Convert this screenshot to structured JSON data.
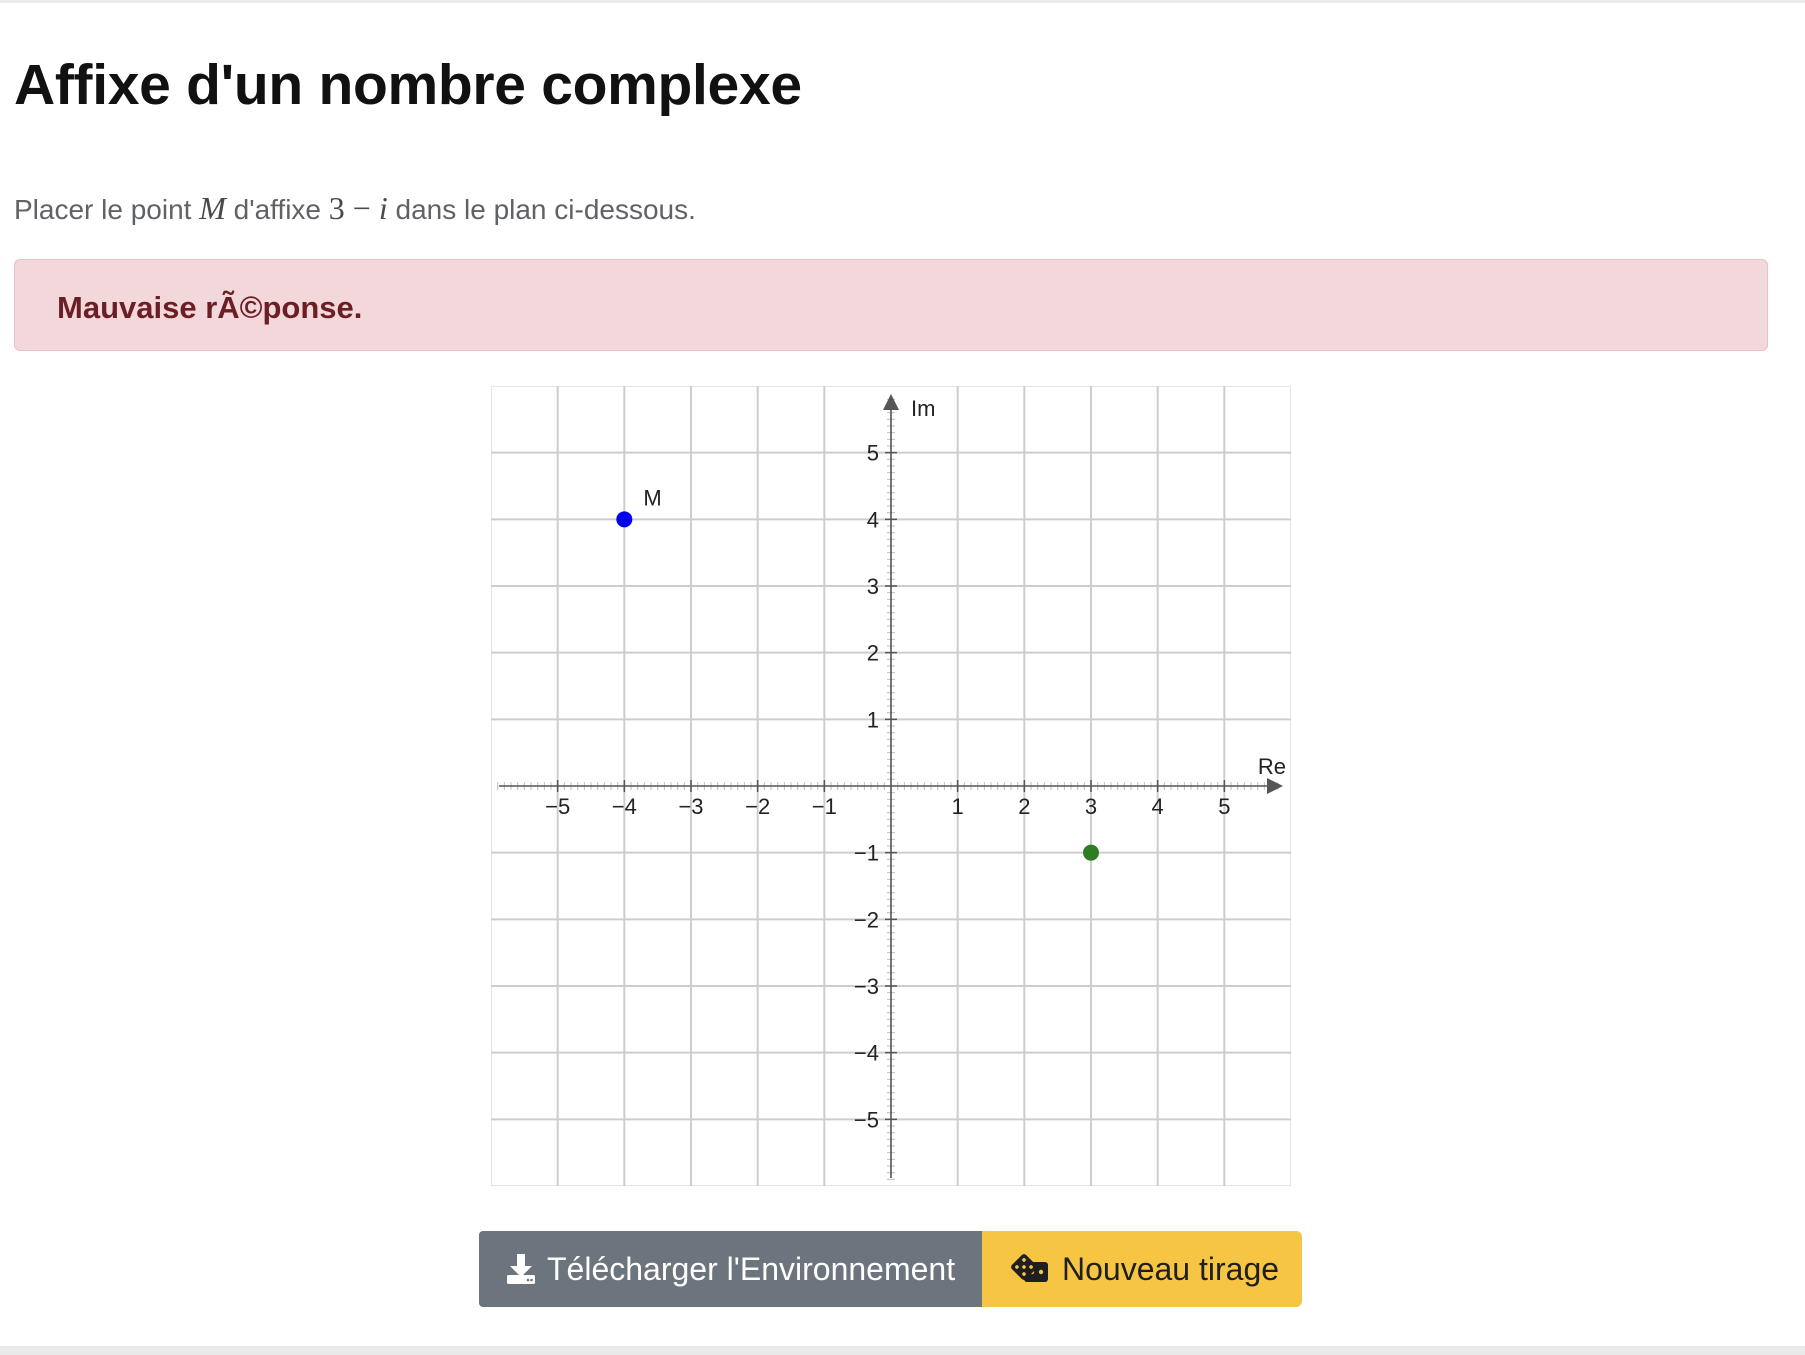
{
  "page": {
    "title": "Affixe d'un nombre complexe",
    "instruction": {
      "prefix": "Placer le point ",
      "point_var": "M",
      "middle": " d'affixe ",
      "affix_real": "3",
      "affix_op": " − ",
      "affix_imag": "i",
      "suffix": " dans le plan ci-dessous."
    },
    "alert": {
      "text": "Mauvaise rÃ©ponse.",
      "bg_color": "#f2d7db",
      "text_color": "#6b1f24"
    }
  },
  "chart_data": {
    "type": "scatter",
    "xlabel": "Re",
    "ylabel": "Im",
    "xlim": [
      -6,
      6
    ],
    "ylim": [
      -6,
      6
    ],
    "x_ticks": [
      -5,
      -4,
      -3,
      -2,
      -1,
      1,
      2,
      3,
      4,
      5
    ],
    "y_ticks": [
      5,
      4,
      3,
      2,
      1,
      -1,
      -2,
      -3,
      -4,
      -5
    ],
    "grid": true,
    "minor_ticks_per_unit": 10,
    "points": [
      {
        "label": "M",
        "x": -4,
        "y": 4,
        "color": "#0000ee"
      },
      {
        "label": "",
        "x": 3,
        "y": -1,
        "color": "#2e7d23"
      }
    ]
  },
  "buttons": {
    "download": {
      "label": "Télécharger l'Environnement",
      "icon": "download-icon",
      "bg_color": "#6c757d"
    },
    "new_draw": {
      "label": "Nouveau tirage",
      "icon": "dice-icon",
      "bg_color": "#f6c544"
    }
  }
}
